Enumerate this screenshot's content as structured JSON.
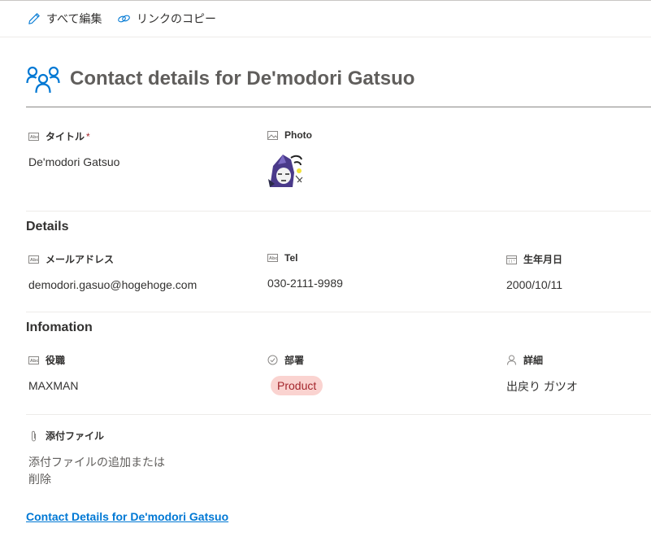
{
  "toolbar": {
    "edit_all_label": "すべて編集",
    "copy_link_label": "リンクのコピー"
  },
  "header": {
    "title": "Contact details for De'modori Gatsuo"
  },
  "summary": {
    "title_field": {
      "label": "タイトル",
      "required_mark": "*",
      "value": "De'modori Gatsuo"
    },
    "photo_field": {
      "label": "Photo"
    }
  },
  "details": {
    "section_title": "Details",
    "email": {
      "label": "メールアドレス",
      "value": "demodori.gasuo@hogehoge.com"
    },
    "tel": {
      "label": "Tel",
      "value": "030-2111-9989"
    },
    "birthday": {
      "label": "生年月日",
      "value": "2000/10/11"
    }
  },
  "infomation": {
    "section_title": "Infomation",
    "role": {
      "label": "役職",
      "value": "MAXMAN"
    },
    "department": {
      "label": "部署",
      "value": "Product"
    },
    "detail": {
      "label": "詳細",
      "value": "出戻り ガツオ"
    }
  },
  "attachments": {
    "label": "添付ファイル",
    "action_line1": "添付ファイルの追加または",
    "action_line2": "削除"
  },
  "footer": {
    "link_text": "Contact Details for De'modori Gatsuo"
  },
  "colors": {
    "accent": "#0078d4",
    "pill_bg": "#fad3d0",
    "pill_text": "#a4262c"
  }
}
